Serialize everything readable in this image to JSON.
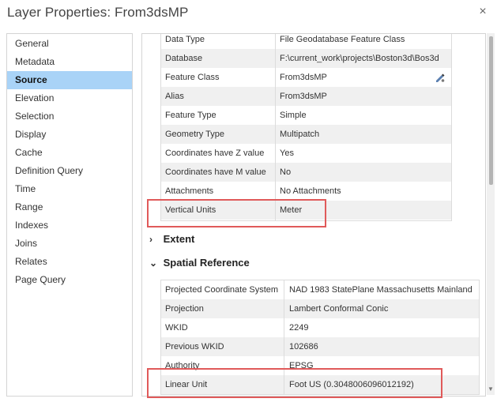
{
  "window": {
    "title": "Layer Properties: From3dsMP",
    "close_glyph": "×"
  },
  "nav": {
    "items": [
      {
        "label": "General"
      },
      {
        "label": "Metadata"
      },
      {
        "label": "Source",
        "active": true
      },
      {
        "label": "Elevation"
      },
      {
        "label": "Selection"
      },
      {
        "label": "Display"
      },
      {
        "label": "Cache"
      },
      {
        "label": "Definition Query"
      },
      {
        "label": "Time"
      },
      {
        "label": "Range"
      },
      {
        "label": "Indexes"
      },
      {
        "label": "Joins"
      },
      {
        "label": "Relates"
      },
      {
        "label": "Page Query"
      }
    ]
  },
  "data_source": {
    "rows": [
      {
        "key": "Data Type",
        "value": "File Geodatabase Feature Class"
      },
      {
        "key": "Database",
        "value": "F:\\current_work\\projects\\Boston3d\\Bos3d"
      },
      {
        "key": "Feature Class",
        "value": "From3dsMP"
      },
      {
        "key": "Alias",
        "value": "From3dsMP"
      },
      {
        "key": "Feature Type",
        "value": "Simple"
      },
      {
        "key": "Geometry Type",
        "value": "Multipatch"
      },
      {
        "key": "Coordinates have Z value",
        "value": "Yes"
      },
      {
        "key": "Coordinates have M value",
        "value": "No"
      },
      {
        "key": "Attachments",
        "value": "No Attachments"
      },
      {
        "key": "Vertical Units",
        "value": "Meter"
      }
    ]
  },
  "sections": {
    "extent": {
      "label": "Extent",
      "chevron": "›"
    },
    "spatial_reference": {
      "label": "Spatial Reference",
      "chevron": "⌄"
    }
  },
  "spatial_reference": {
    "rows": [
      {
        "key": "Projected Coordinate System",
        "value": "NAD 1983 StatePlane Massachusetts Mainland"
      },
      {
        "key": "Projection",
        "value": "Lambert Conformal Conic"
      },
      {
        "key": "WKID",
        "value": "2249"
      },
      {
        "key": "Previous WKID",
        "value": "102686"
      },
      {
        "key": "Authority",
        "value": "EPSG"
      },
      {
        "key": "Linear Unit",
        "value": "Foot US (0.3048006096012192)"
      }
    ]
  },
  "colors": {
    "active_nav": "#a9d3f7",
    "highlight": "#e05a5a"
  }
}
